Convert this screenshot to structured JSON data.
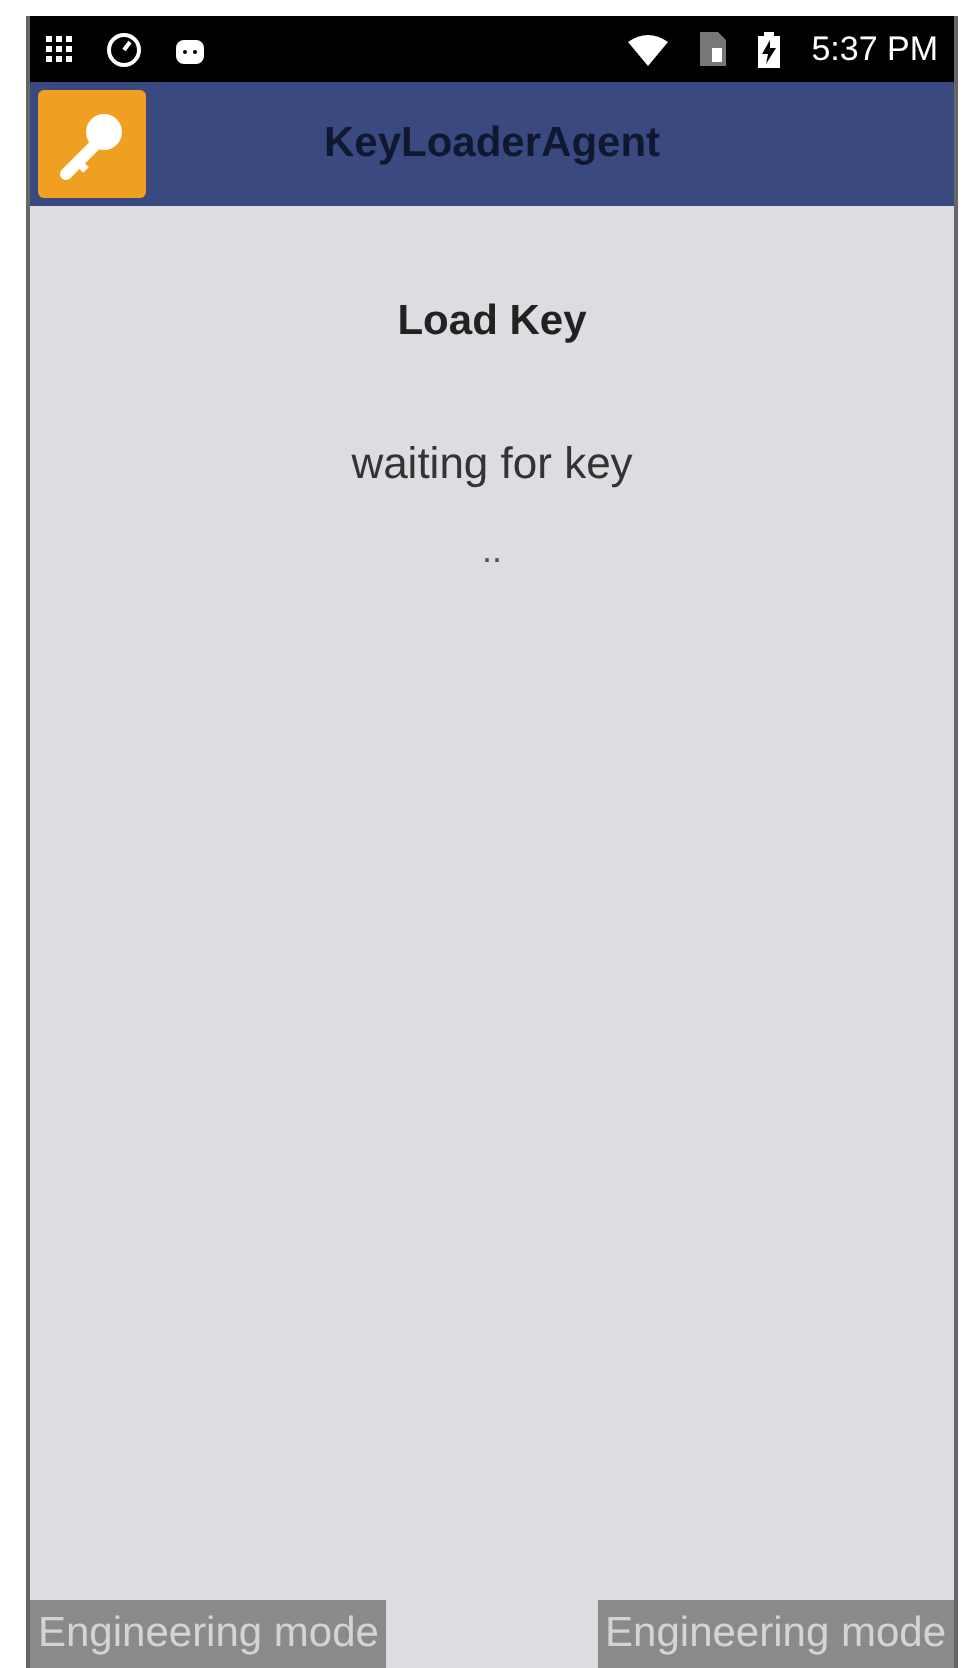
{
  "status_bar": {
    "time": "5:37 PM"
  },
  "app_bar": {
    "title": "KeyLoaderAgent"
  },
  "content": {
    "heading": "Load Key",
    "message": "waiting for key",
    "progress": ".."
  },
  "buttons": [
    {
      "label": "Engineering mode"
    },
    {
      "label": "Engineering mode"
    }
  ]
}
